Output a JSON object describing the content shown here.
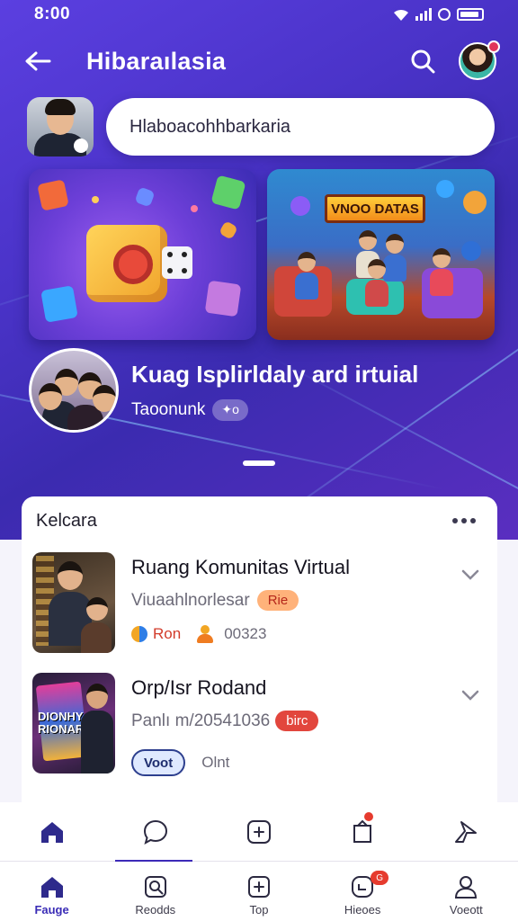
{
  "status": {
    "time": "8:00"
  },
  "header": {
    "title": "Hibaraılasia"
  },
  "search": {
    "value": "Hlaboacohhbarkaria"
  },
  "banners": [
    {
      "name": "game-dice-banner"
    },
    {
      "name": "show-banner",
      "sign_text": "VNOO DATAS"
    }
  ],
  "featured": {
    "title": "Kuag Isplirldaly ard irtuial",
    "subtitle": "Taoonunk",
    "chip": "✦o"
  },
  "panel": {
    "title": "Kelcara",
    "items": [
      {
        "title": "Ruang Komunitas Virtual",
        "subtitle": "Viuaahlnorlesar",
        "pill": "Rie",
        "meta_name": "Ron",
        "meta_count": "00323"
      },
      {
        "title": "Orp/Isr Rodand",
        "subtitle": "Panlı m/20541036",
        "pill": "birc",
        "button": "Voot",
        "meta_text": "Olnt",
        "thumb_text": "DIONHY RIONAR"
      }
    ]
  },
  "bottom_nav": [
    {
      "label": "Fauge",
      "icon": "home-icon"
    },
    {
      "label": "Reodds",
      "icon": "search-doc-icon"
    },
    {
      "label": "Top",
      "icon": "add-icon"
    },
    {
      "label": "Hieoes",
      "icon": "bell-icon",
      "badge": "G"
    },
    {
      "label": "Voeott",
      "icon": "profile-icon"
    }
  ],
  "colors": {
    "accent": "#3c2ab8",
    "hero": "#4a33c8",
    "danger": "#e2463d"
  }
}
